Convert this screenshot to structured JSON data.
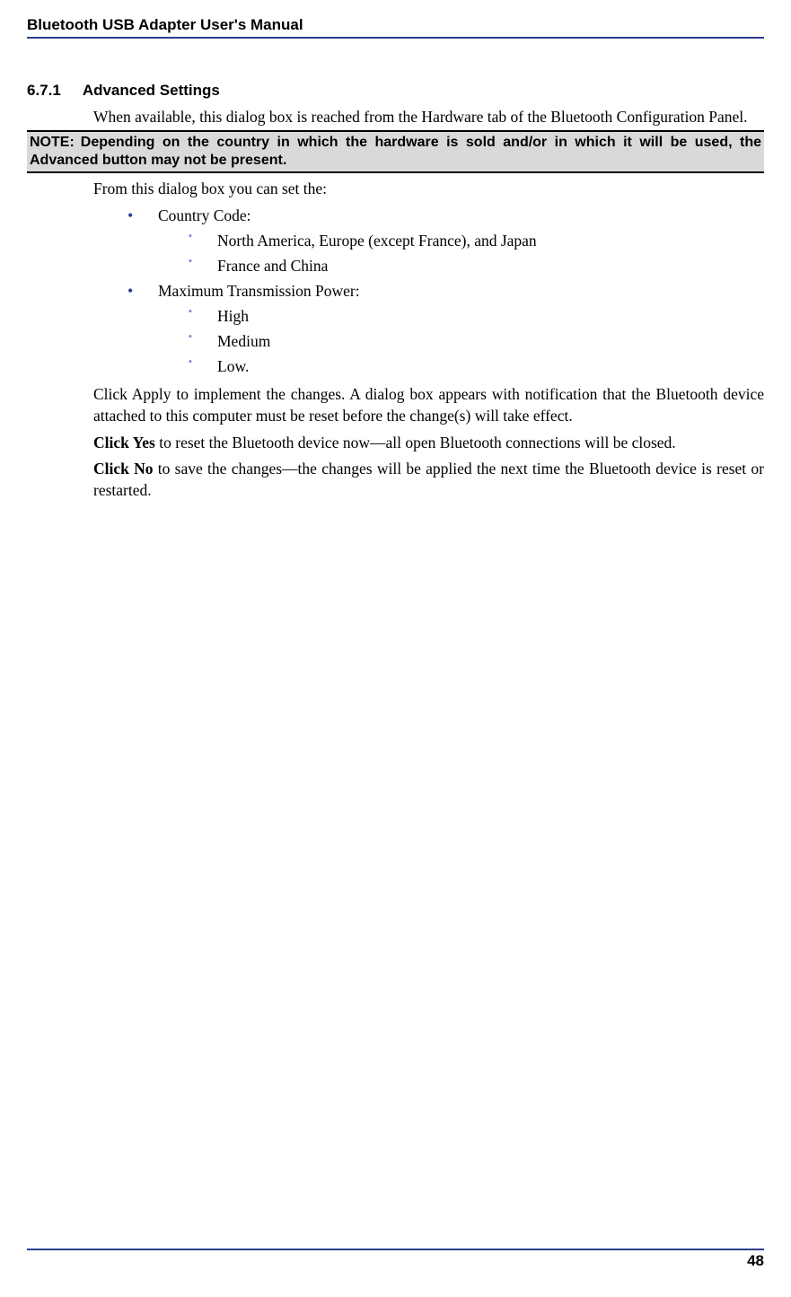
{
  "header": {
    "title": "Bluetooth USB Adapter User's Manual"
  },
  "section": {
    "number": "6.7.1",
    "title": "Advanced Settings",
    "intro": "When available, this dialog box is reached from the Hardware tab of the Bluetooth Configuration Panel."
  },
  "note": {
    "label": "NOTE:",
    "text": "Depending on the country in which the hardware is sold and/or in which it will be used, the Advanced button may not be present."
  },
  "body": {
    "lead": "From this dialog box you can set the:",
    "bullets": [
      {
        "label": "Country Code:",
        "sub": [
          "North America, Europe (except France), and Japan",
          "France and China"
        ]
      },
      {
        "label": "Maximum Transmission Power:",
        "sub": [
          "High",
          "Medium",
          "Low."
        ]
      }
    ],
    "apply": "Click Apply to implement the changes. A dialog box appears with notification that the Bluetooth device attached to this computer must be reset before the change(s) will take effect.",
    "yes_bold": "Click Yes",
    "yes_rest": " to reset the Bluetooth device now—all open Bluetooth connections will be closed.",
    "no_bold": "Click No",
    "no_rest": " to save the changes—the changes will be applied the next time the Bluetooth device is reset or restarted."
  },
  "footer": {
    "page": "48"
  }
}
